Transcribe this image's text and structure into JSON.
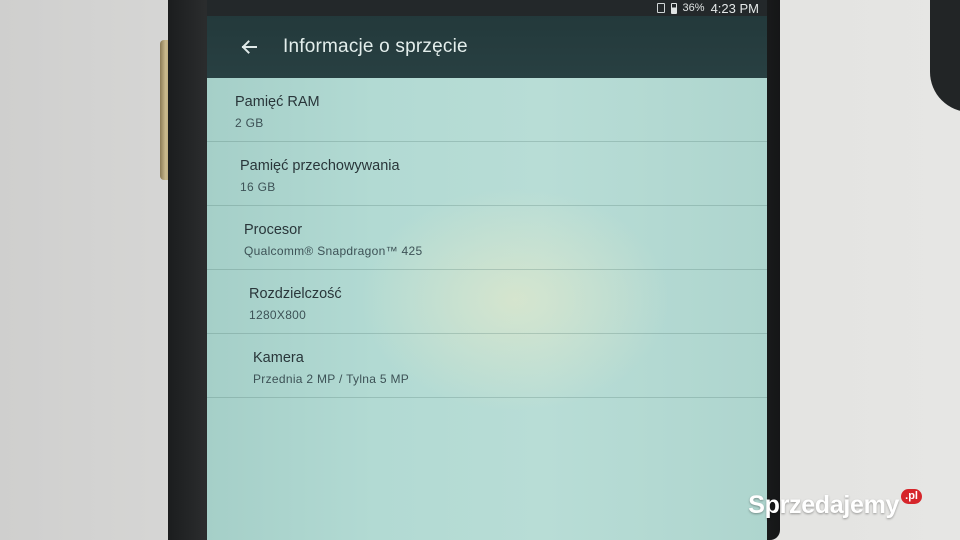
{
  "status_bar": {
    "battery": "36%",
    "time": "4:23 PM"
  },
  "app_bar": {
    "back_icon": "arrow-left-icon",
    "title": "Informacje o sprzęcie"
  },
  "hardware_items": [
    {
      "title": "Pamięć RAM",
      "value": "2 GB"
    },
    {
      "title": "Pamięć przechowywania",
      "value": "16 GB"
    },
    {
      "title": "Procesor",
      "value": "Qualcomm® Snapdragon™ 425"
    },
    {
      "title": "Rozdzielczość",
      "value": "1280X800"
    },
    {
      "title": "Kamera",
      "value": "Przednia 2 MP / Tylna 5 MP"
    }
  ],
  "watermark": {
    "text": "Sprzedajemy",
    "badge": ".pl"
  },
  "colors": {
    "app_bar": "#23393b",
    "screen_background": "#b2dad3",
    "watermark_badge": "#d6262b"
  }
}
